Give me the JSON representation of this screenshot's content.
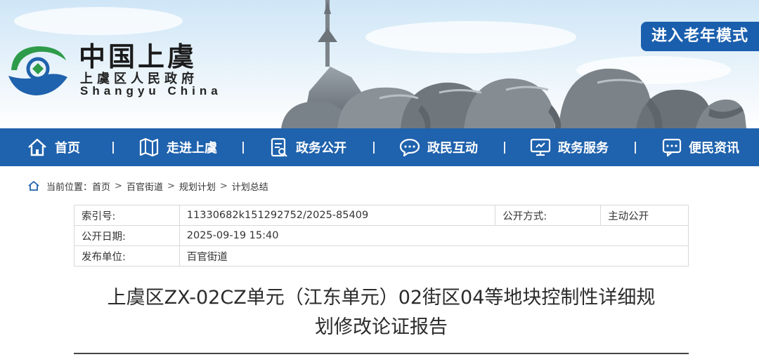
{
  "header": {
    "logo_cn": "中国上虞",
    "logo_sub": "上虞区人民政府",
    "logo_en": "Shangyu China",
    "elder_mode": "进入老年模式"
  },
  "nav": {
    "items": [
      {
        "label": "首页",
        "icon": "home-icon"
      },
      {
        "label": "走进上虞",
        "icon": "map-icon"
      },
      {
        "label": "政务公开",
        "icon": "document-icon"
      },
      {
        "label": "政民互动",
        "icon": "chat-icon"
      },
      {
        "label": "政务服务",
        "icon": "monitor-icon"
      },
      {
        "label": "便民资讯",
        "icon": "message-icon"
      }
    ]
  },
  "breadcrumb": {
    "prefix": "当前位置：",
    "items": [
      "首页",
      "百官街道",
      "规划计划",
      "计划总结"
    ],
    "separator": ">"
  },
  "meta": {
    "index_label": "索引号:",
    "index_value": "11330682k151292752/2025-85409",
    "method_label": "公开方式:",
    "method_value": "主动公开",
    "date_label": "公开日期:",
    "date_value": "2025-09-19 15:40",
    "unit_label": "发布单位:",
    "unit_value": "百官街道"
  },
  "article": {
    "title_line1": "上虞区ZX-02CZ单元（江东单元）02街区04等地块控制性详细规",
    "title_line2": "划修改论证报告"
  },
  "colors": {
    "nav_bg": "#1f62ad",
    "elder_btn_bg": "#1a5fae",
    "logo_green": "#2e9b4a",
    "logo_blue": "#1f62ad"
  }
}
